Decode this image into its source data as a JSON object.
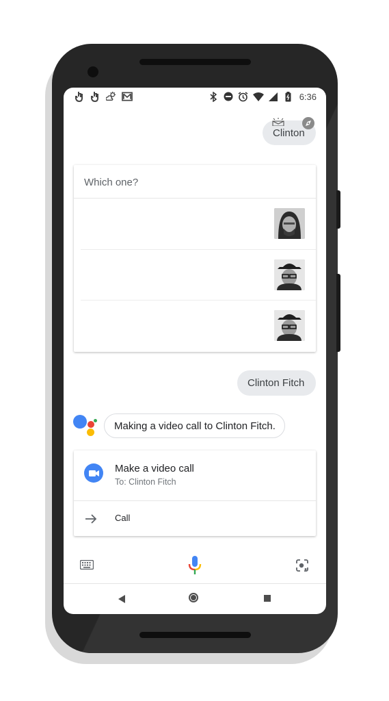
{
  "status_bar": {
    "time": "6:36",
    "left_icons": [
      "gesture-icon",
      "gesture-icon",
      "weather-icon",
      "gmail-icon"
    ],
    "right_icons": [
      "bluetooth-icon",
      "do-not-disturb-icon",
      "alarm-icon",
      "wifi-icon",
      "signal-icon",
      "battery-icon"
    ]
  },
  "query_chip": {
    "label": "Clinton"
  },
  "disambiguation": {
    "title": "Which one?",
    "options": [
      {
        "avatar": "contact-photo-1"
      },
      {
        "avatar": "contact-photo-2"
      },
      {
        "avatar": "contact-photo-3"
      }
    ]
  },
  "selection_chip": {
    "label": "Clinton Fitch"
  },
  "assistant": {
    "response": "Making a video call to Clinton Fitch."
  },
  "call_card": {
    "title": "Make a video call",
    "subtitle": "To: Clinton Fitch",
    "action_label": "Call"
  },
  "bottom_bar": {
    "icons": [
      "keyboard-icon",
      "microphone-icon",
      "lens-icon"
    ]
  },
  "nav_bar": {
    "icons": [
      "back-icon",
      "home-icon",
      "recents-icon"
    ]
  },
  "colors": {
    "google_blue": "#4285f4",
    "google_red": "#ea4335",
    "google_yellow": "#fbbc04",
    "google_green": "#34a853",
    "chip_bg": "#e8eaed"
  }
}
